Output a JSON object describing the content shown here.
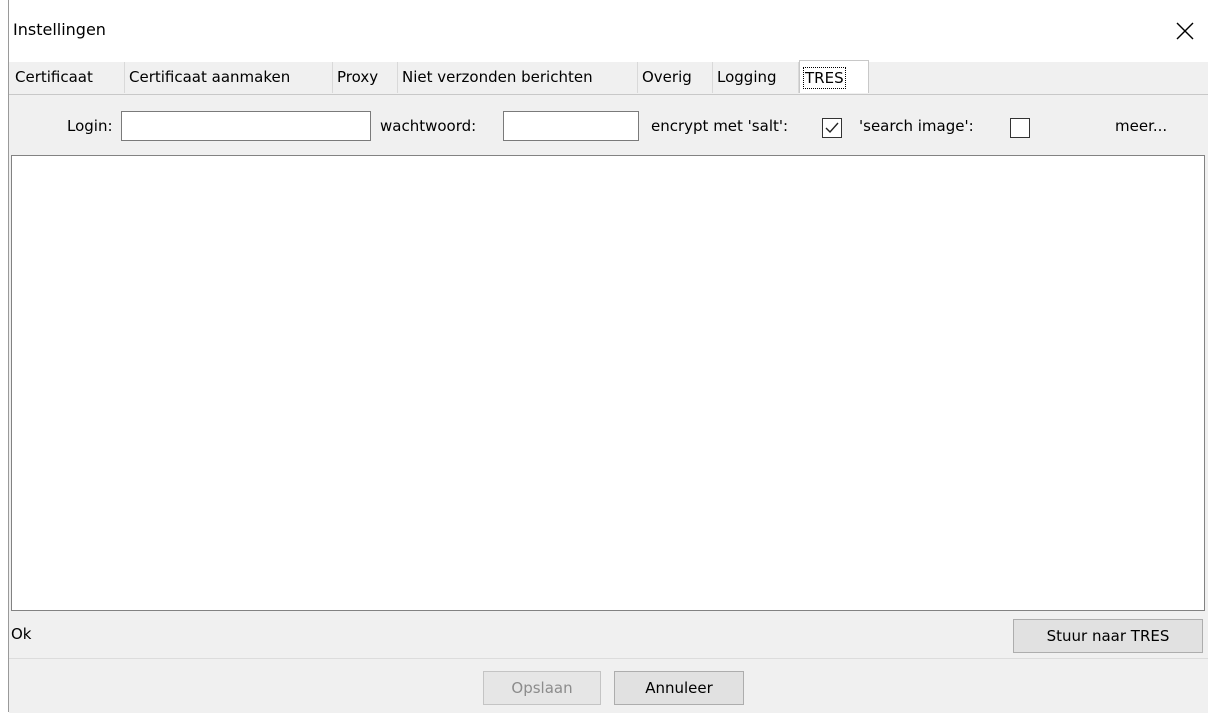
{
  "window": {
    "title": "Instellingen"
  },
  "tabs": [
    {
      "label": "Certificaat"
    },
    {
      "label": "Certificaat aanmaken"
    },
    {
      "label": "Proxy"
    },
    {
      "label": "Niet verzonden berichten"
    },
    {
      "label": "Overig"
    },
    {
      "label": "Logging"
    },
    {
      "label": "TRES",
      "active": true
    }
  ],
  "form": {
    "login_label": "Login:",
    "login_value": "",
    "password_label": "wachtwoord:",
    "password_value": "",
    "salt_label": "encrypt met 'salt':",
    "salt_checked": true,
    "search_label": "'search image':",
    "search_checked": false,
    "more_label": "meer..."
  },
  "output": {
    "text": ""
  },
  "status": {
    "text": "Ok"
  },
  "buttons": {
    "send_label": "Stuur naar TRES",
    "save_label": "Opslaan",
    "cancel_label": "Annuleer"
  }
}
